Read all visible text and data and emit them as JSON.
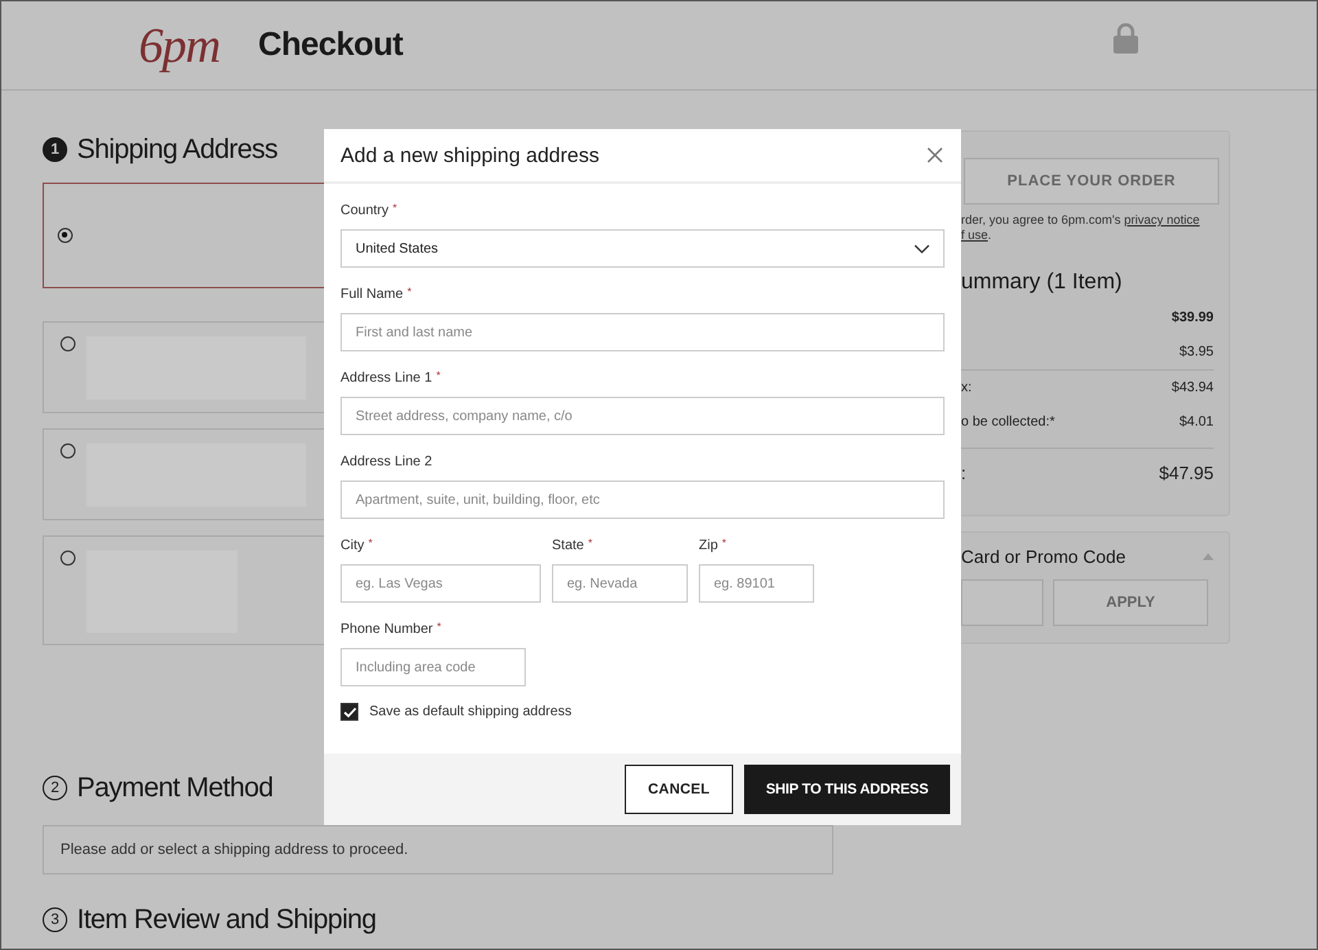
{
  "header": {
    "logo": "6pm",
    "title": "Checkout"
  },
  "sections": [
    {
      "number": "1",
      "title": "Shipping Address",
      "current": true
    },
    {
      "number": "2",
      "title": "Payment Method",
      "current": false
    },
    {
      "number": "3",
      "title": "Item Review and Shipping",
      "current": false
    }
  ],
  "addresses": [
    {
      "selected": true
    },
    {
      "selected": false
    },
    {
      "selected": false
    },
    {
      "selected": false
    }
  ],
  "payment_message": "Please add or select a shipping address to proceed.",
  "order_panel": {
    "place_order_button": "PLACE YOUR ORDER",
    "disabled": true,
    "agreement": [
      {
        "text": "rder, you agree to 6pm.com's ",
        "link": "privacy notice"
      },
      {
        "link": "f use",
        "text": "."
      }
    ],
    "summary_title": "ummary (1 Item)",
    "summary_rows": [
      {
        "kind": "bold",
        "value": "$39.99",
        "divider_above": false
      },
      {
        "kind": "plain",
        "value": "$3.95",
        "divider_above": false
      },
      {
        "kind": "plain",
        "label": "x:",
        "value": "$43.94",
        "divider_above": true
      },
      {
        "kind": "plain",
        "label": "o be collected:*",
        "value": "$4.01",
        "divider_above": false
      },
      {
        "kind": "total",
        "label": ":",
        "value": "$47.95",
        "divider_above": true
      }
    ]
  },
  "promo": {
    "title": "Card or Promo Code",
    "expanded": true,
    "apply_button": "APPLY"
  },
  "modal": {
    "title": "Add a new shipping address",
    "rows": [
      [
        {
          "kind": "select",
          "label": "Country",
          "required_mark": "*",
          "value": "United States"
        }
      ],
      [
        {
          "kind": "text",
          "label": "Full Name",
          "required_mark": "*",
          "placeholder": "First and last name"
        }
      ],
      [
        {
          "kind": "text",
          "label": "Address Line 1",
          "required_mark": "*",
          "placeholder": "Street address, company name, c/o"
        }
      ],
      [
        {
          "kind": "text",
          "label": "Address Line 2",
          "placeholder": "Apartment, suite, unit, building, floor, etc"
        }
      ],
      [
        {
          "kind": "short",
          "label": "City",
          "required_mark": "*",
          "placeholder": "eg. Las Vegas"
        },
        {
          "kind": "short",
          "label": "State",
          "required_mark": "*",
          "placeholder": "eg. Nevada"
        },
        {
          "kind": "short",
          "label": "Zip",
          "required_mark": "*",
          "placeholder": "eg. 89101"
        }
      ],
      [
        {
          "kind": "short",
          "label": "Phone Number",
          "required_mark": "*",
          "placeholder": "Including area code"
        }
      ]
    ],
    "checkbox": {
      "label": "Save as default shipping address",
      "checked": true
    },
    "buttons": [
      {
        "label": "CANCEL",
        "kind": "secondary"
      },
      {
        "label": "SHIP TO THIS ADDRESS",
        "kind": "primary"
      }
    ]
  }
}
